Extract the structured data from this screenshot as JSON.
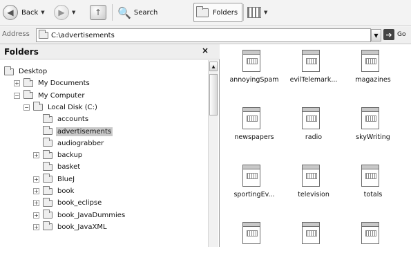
{
  "toolbar": {
    "back_label": "Back",
    "search_label": "Search",
    "folders_label": "Folders"
  },
  "address": {
    "label": "Address",
    "value": "C:\\advertisements",
    "go_label": "Go"
  },
  "folders_pane": {
    "title": "Folders",
    "close_glyph": "×",
    "tree": [
      {
        "label": "Desktop",
        "expander": "",
        "icon": "desktop-icon"
      },
      {
        "label": "My Documents",
        "expander": "+",
        "icon": "folder-icon"
      },
      {
        "label": "My Computer",
        "expander": "−",
        "icon": "computer-icon"
      },
      {
        "label": "Local Disk (C:)",
        "expander": "−",
        "icon": "drive-icon"
      },
      {
        "label": "accounts",
        "expander": "",
        "icon": "folder-icon"
      },
      {
        "label": "advertisements",
        "expander": "",
        "icon": "folder-icon",
        "selected": true
      },
      {
        "label": "audiograbber",
        "expander": "",
        "icon": "folder-icon"
      },
      {
        "label": "backup",
        "expander": "+",
        "icon": "folder-icon"
      },
      {
        "label": "basket",
        "expander": "",
        "icon": "folder-icon"
      },
      {
        "label": "BlueJ",
        "expander": "+",
        "icon": "folder-icon"
      },
      {
        "label": "book",
        "expander": "+",
        "icon": "folder-icon"
      },
      {
        "label": "book_eclipse",
        "expander": "+",
        "icon": "folder-icon"
      },
      {
        "label": "book_JavaDummies",
        "expander": "+",
        "icon": "folder-icon"
      },
      {
        "label": "book_JavaXML",
        "expander": "+",
        "icon": "folder-icon"
      }
    ]
  },
  "files": [
    {
      "label": "annoyingSpam"
    },
    {
      "label": "evilTelemark..."
    },
    {
      "label": "magazines"
    },
    {
      "label": "newspapers"
    },
    {
      "label": "radio"
    },
    {
      "label": "skyWriting"
    },
    {
      "label": "sportingEv..."
    },
    {
      "label": "television"
    },
    {
      "label": "totals"
    },
    {
      "label": ""
    },
    {
      "label": ""
    },
    {
      "label": ""
    }
  ]
}
